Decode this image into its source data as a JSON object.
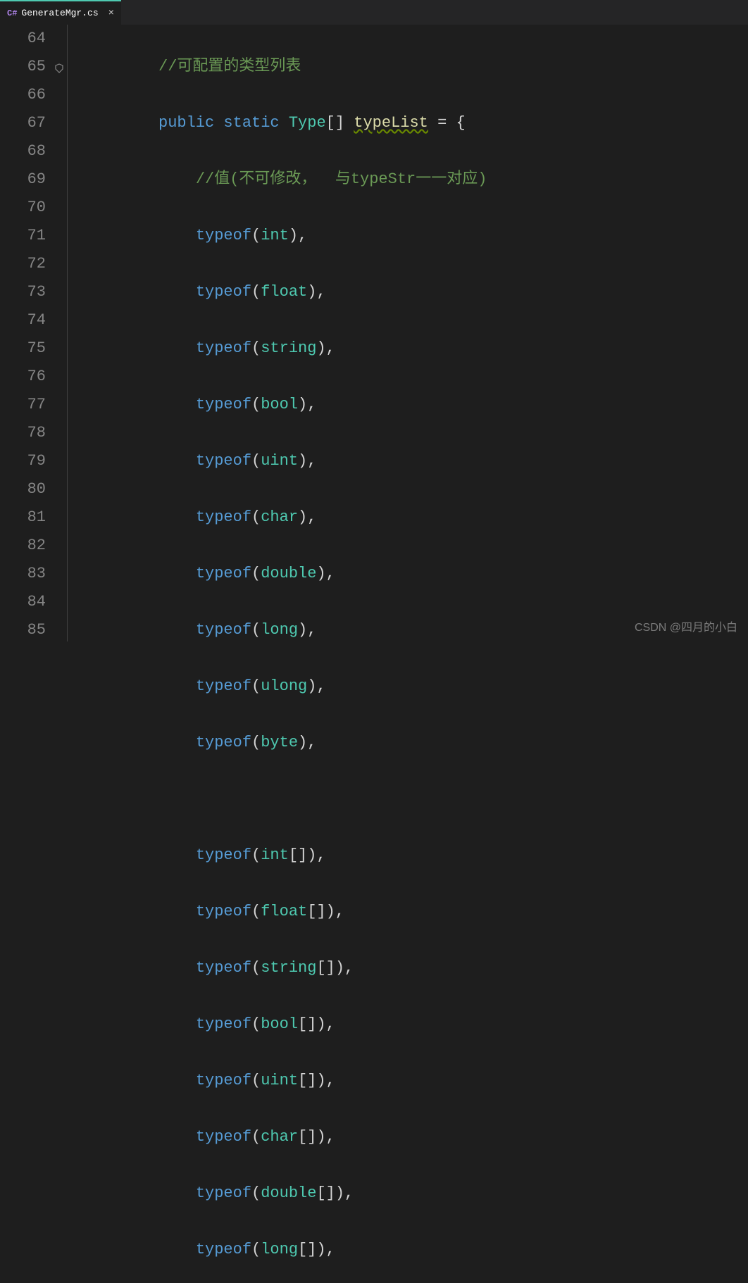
{
  "tab": {
    "lang_prefix": "C#",
    "filename": "GenerateMgr.cs",
    "close": "×"
  },
  "line_numbers": [
    "64",
    "65",
    "66",
    "67",
    "68",
    "69",
    "70",
    "71",
    "72",
    "73",
    "74",
    "75",
    "76",
    "77",
    "78",
    "79",
    "80",
    "81",
    "82",
    "83",
    "84",
    "85"
  ],
  "code": {
    "l64_comment": "//可配置的类型列表",
    "l65": {
      "kw_public": "public",
      "kw_static": "static",
      "type": "Type",
      "brackets": "[]",
      "var": "typeList",
      "eq": " = {"
    },
    "l66_comment": "//值(不可修改，  与typeStr一一对应)",
    "l67": {
      "kw": "typeof",
      "open": "(",
      "t": "int",
      "close": "),"
    },
    "l68": {
      "kw": "typeof",
      "open": "(",
      "t": "float",
      "close": "),"
    },
    "l69": {
      "kw": "typeof",
      "open": "(",
      "t": "string",
      "close": "),"
    },
    "l70": {
      "kw": "typeof",
      "open": "(",
      "t": "bool",
      "close": "),"
    },
    "l71": {
      "kw": "typeof",
      "open": "(",
      "t": "uint",
      "close": "),"
    },
    "l72": {
      "kw": "typeof",
      "open": "(",
      "t": "char",
      "close": "),"
    },
    "l73": {
      "kw": "typeof",
      "open": "(",
      "t": "double",
      "close": "),"
    },
    "l74": {
      "kw": "typeof",
      "open": "(",
      "t": "long",
      "close": "),"
    },
    "l75": {
      "kw": "typeof",
      "open": "(",
      "t": "ulong",
      "close": "),"
    },
    "l76": {
      "kw": "typeof",
      "open": "(",
      "t": "byte",
      "close": "),"
    },
    "l78": {
      "kw": "typeof",
      "open": "(",
      "t": "int",
      "arr": "[]",
      "close": "),"
    },
    "l79": {
      "kw": "typeof",
      "open": "(",
      "t": "float",
      "arr": "[]",
      "close": "),"
    },
    "l80": {
      "kw": "typeof",
      "open": "(",
      "t": "string",
      "arr": "[]",
      "close": "),"
    },
    "l81": {
      "kw": "typeof",
      "open": "(",
      "t": "bool",
      "arr": "[]",
      "close": "),"
    },
    "l82": {
      "kw": "typeof",
      "open": "(",
      "t": "uint",
      "arr": "[]",
      "close": "),"
    },
    "l83": {
      "kw": "typeof",
      "open": "(",
      "t": "char",
      "arr": "[]",
      "close": "),"
    },
    "l84": {
      "kw": "typeof",
      "open": "(",
      "t": "double",
      "arr": "[]",
      "close": "),"
    },
    "l85": {
      "kw": "typeof",
      "open": "(",
      "t": "long",
      "arr": "[]",
      "close": "),"
    }
  },
  "watermark": "CSDN @四月的小白"
}
